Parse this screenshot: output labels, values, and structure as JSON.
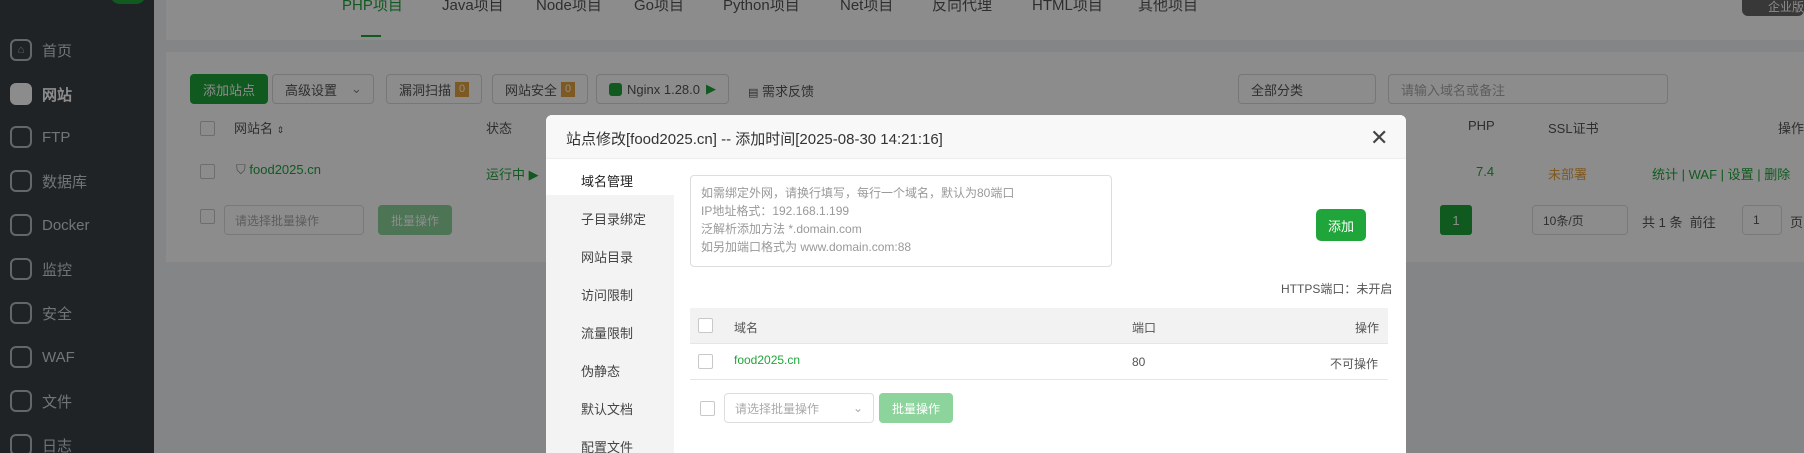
{
  "sidebar": {
    "items": [
      {
        "label": "首页",
        "icon": "home-icon"
      },
      {
        "label": "网站",
        "icon": "globe-icon"
      },
      {
        "label": "FTP",
        "icon": "ftp-icon"
      },
      {
        "label": "数据库",
        "icon": "database-icon"
      },
      {
        "label": "Docker",
        "icon": "docker-icon"
      },
      {
        "label": "监控",
        "icon": "monitor-icon"
      },
      {
        "label": "安全",
        "icon": "shield-icon"
      },
      {
        "label": "WAF",
        "icon": "waf-icon"
      },
      {
        "label": "文件",
        "icon": "folder-icon"
      },
      {
        "label": "日志",
        "icon": "log-icon"
      }
    ]
  },
  "tabs": [
    "PHP项目",
    "Java项目",
    "Node项目",
    "Go项目",
    "Python项目",
    "Net项目",
    "反向代理",
    "HTML项目",
    "其他项目"
  ],
  "topright": {
    "label": "企业版"
  },
  "toolbar": {
    "add_site": "添加站点",
    "advanced": "高级设置",
    "vuln_scan": "漏洞扫描",
    "vuln_count": "0",
    "site_security": "网站安全",
    "security_count": "0",
    "nginx": "Nginx 1.28.0",
    "feedback": "需求反馈",
    "category": "全部分类",
    "search_placeholder": "请输入域名或备注"
  },
  "site_table": {
    "headers": {
      "name": "网站名",
      "status": "状态",
      "php": "PHP",
      "ssl": "SSL证书",
      "ops": "操作"
    },
    "row": {
      "name": "food2025.cn",
      "status": "运行中",
      "php": "7.4",
      "ssl": "未部署",
      "ops": [
        "统计",
        "WAF",
        "设置",
        "删除"
      ]
    },
    "batch_placeholder": "请选择批量操作",
    "batch_button": "批量操作"
  },
  "pagination": {
    "current": "1",
    "per_page": "10条/页",
    "total": "共 1 条",
    "goto": "前往",
    "goto_value": "1",
    "page_suffix": "页"
  },
  "modal": {
    "title": "站点修改[food2025.cn] -- 添加时间[2025-08-30 14:21:16]",
    "nav": [
      "域名管理",
      "子目录绑定",
      "网站目录",
      "访问限制",
      "流量限制",
      "伪静态",
      "默认文档",
      "配置文件"
    ],
    "textarea_lines": [
      "如需绑定外网，请换行填写，每行一个域名，默认为80端口",
      "IP地址格式：192.168.1.199",
      "泛解析添加方法 *.domain.com",
      "如另加端口格式为 www.domain.com:88"
    ],
    "add_button": "添加",
    "https_port": "HTTPS端口：未开启",
    "table_headers": {
      "domain": "域名",
      "port": "端口",
      "ops": "操作"
    },
    "row": {
      "domain": "food2025.cn",
      "port": "80",
      "ops": "不可操作"
    },
    "batch_placeholder": "请选择批量操作",
    "batch_button": "批量操作"
  }
}
